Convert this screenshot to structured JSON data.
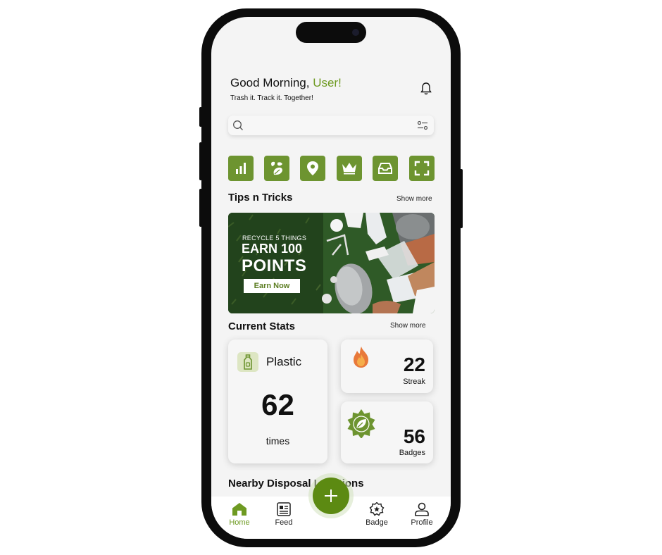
{
  "header": {
    "greeting": "Good Morning,",
    "user": "User!",
    "tagline": "Trash it. Track it. Together!"
  },
  "search": {
    "placeholder": ""
  },
  "categories": [
    {
      "icon": "bar-chart-icon"
    },
    {
      "icon": "leaves-icon"
    },
    {
      "icon": "location-pin-icon"
    },
    {
      "icon": "crown-icon"
    },
    {
      "icon": "inbox-tray-icon"
    },
    {
      "icon": "scan-frame-icon"
    }
  ],
  "tips": {
    "title": "Tips n Tricks",
    "show_more": "Show more",
    "banner": {
      "kicker": "RECYCLE 5 THINGS",
      "line1": "EARN 100",
      "line2": "POINTS",
      "cta": "Earn Now"
    }
  },
  "stats": {
    "title": "Current Stats",
    "show_more": "Show more",
    "plastic": {
      "label": "Plastic",
      "value": "62",
      "unit": "times"
    },
    "streak": {
      "value": "22",
      "label": "Streak"
    },
    "badges": {
      "value": "56",
      "label": "Badges"
    }
  },
  "nearby": {
    "title": "Nearby Disposal Locations"
  },
  "nav": [
    {
      "label": "Home",
      "icon": "home-icon",
      "active": true
    },
    {
      "label": "Feed",
      "icon": "feed-icon"
    },
    {
      "label": "Badge",
      "icon": "badge-icon"
    },
    {
      "label": "Profile",
      "icon": "profile-icon"
    }
  ],
  "colors": {
    "accent": "#6e9a22",
    "category_bg": "#6d9430",
    "fab": "#5c8a12",
    "background": "#f4f4f4"
  }
}
